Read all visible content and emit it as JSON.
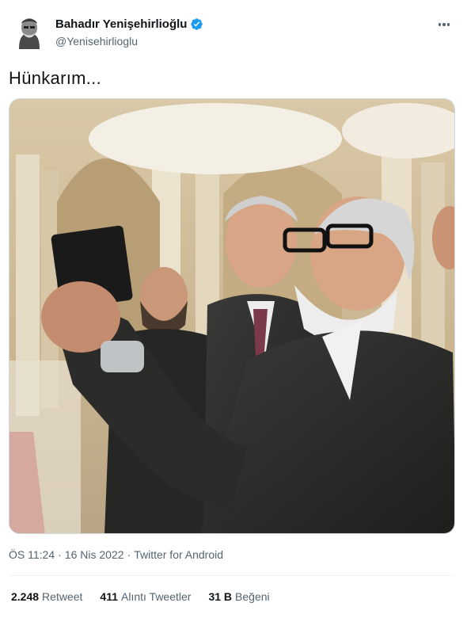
{
  "author": {
    "display_name": "Bahadır Yenişehirlioğlu",
    "handle": "@Yenisehirlioglu",
    "verified": true,
    "avatar_icon": "avatar-portrait-icon",
    "verified_icon": "verified-badge-icon"
  },
  "more_icon": "more-horizontal-icon",
  "tweet": {
    "text": "Hünkarım..."
  },
  "meta": {
    "time": "ÖS 11:24",
    "separator": "·",
    "date": "16 Nis 2022",
    "source": "Twitter for Android"
  },
  "stats": {
    "retweets": {
      "count": "2.248",
      "label": "Retweet"
    },
    "quotes": {
      "count": "411",
      "label": "Alıntı Tweetler"
    },
    "likes": {
      "count": "31 B",
      "label": "Beğeni"
    }
  },
  "colors": {
    "verified_blue": "#1d9bf0",
    "secondary_text": "#536471",
    "primary_text": "#0f1419"
  }
}
